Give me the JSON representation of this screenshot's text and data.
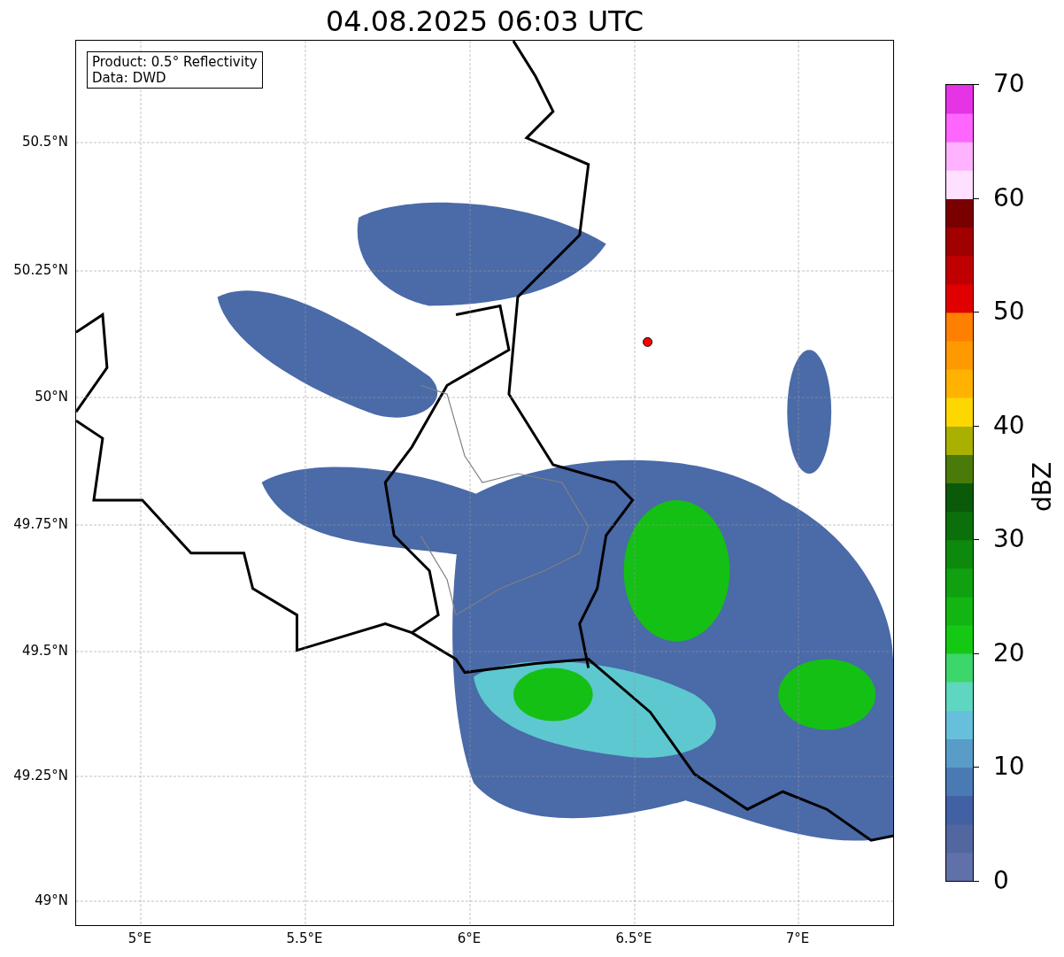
{
  "title": "04.08.2025 06:03 UTC",
  "info_box": [
    "Product: 0.5° Reflectivity",
    "Data: DWD"
  ],
  "map": {
    "lat_ticks": [
      "50.5°N",
      "50.25°N",
      "50°N",
      "49.75°N",
      "49.5°N",
      "49.25°N",
      "49°N"
    ],
    "lon_ticks": [
      "5°E",
      "5.5°E",
      "6°E",
      "6.5°E",
      "7°E"
    ]
  },
  "colorbar": {
    "label": "dBZ",
    "ticks": [
      "70",
      "60",
      "50",
      "40",
      "30",
      "20",
      "10",
      "0"
    ],
    "segments": [
      {
        "color": "#6070a8"
      },
      {
        "color": "#5266a0"
      },
      {
        "color": "#4260a4"
      },
      {
        "color": "#4a7ab4"
      },
      {
        "color": "#5a9cc8"
      },
      {
        "color": "#66c0dc"
      },
      {
        "color": "#5ed6c0"
      },
      {
        "color": "#3dd66a"
      },
      {
        "color": "#14c814"
      },
      {
        "color": "#12b512"
      },
      {
        "color": "#10a010"
      },
      {
        "color": "#0d8a0d"
      },
      {
        "color": "#0b700b"
      },
      {
        "color": "#0a5a0a"
      },
      {
        "color": "#4a7a0a"
      },
      {
        "color": "#aab000"
      },
      {
        "color": "#ffd700"
      },
      {
        "color": "#ffb300"
      },
      {
        "color": "#ff9900"
      },
      {
        "color": "#ff8000"
      },
      {
        "color": "#e00000"
      },
      {
        "color": "#c00000"
      },
      {
        "color": "#a00000"
      },
      {
        "color": "#7a0000"
      },
      {
        "color": "#ffe0ff"
      },
      {
        "color": "#ffb3ff"
      },
      {
        "color": "#ff66ff"
      },
      {
        "color": "#e633e6"
      }
    ]
  }
}
